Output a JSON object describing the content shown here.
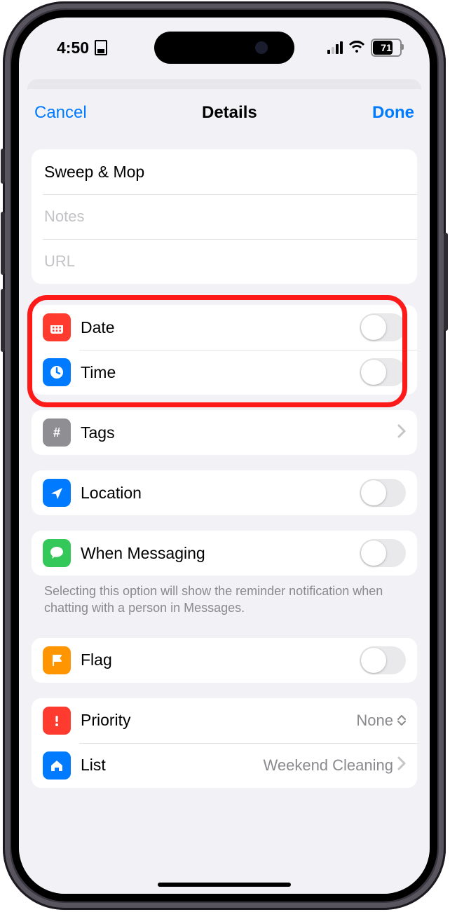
{
  "statusbar": {
    "time": "4:50",
    "battery_pct": "71"
  },
  "nav": {
    "cancel": "Cancel",
    "title": "Details",
    "done": "Done"
  },
  "fields": {
    "title_value": "Sweep & Mop",
    "notes_placeholder": "Notes",
    "url_placeholder": "URL"
  },
  "rows": {
    "date": "Date",
    "time": "Time",
    "tags": "Tags",
    "location": "Location",
    "messaging": "When Messaging",
    "flag": "Flag",
    "priority": "Priority",
    "priority_value": "None",
    "list": "List",
    "list_value": "Weekend Cleaning"
  },
  "footnote": "Selecting this option will show the reminder notification when chatting with a person in Messages."
}
